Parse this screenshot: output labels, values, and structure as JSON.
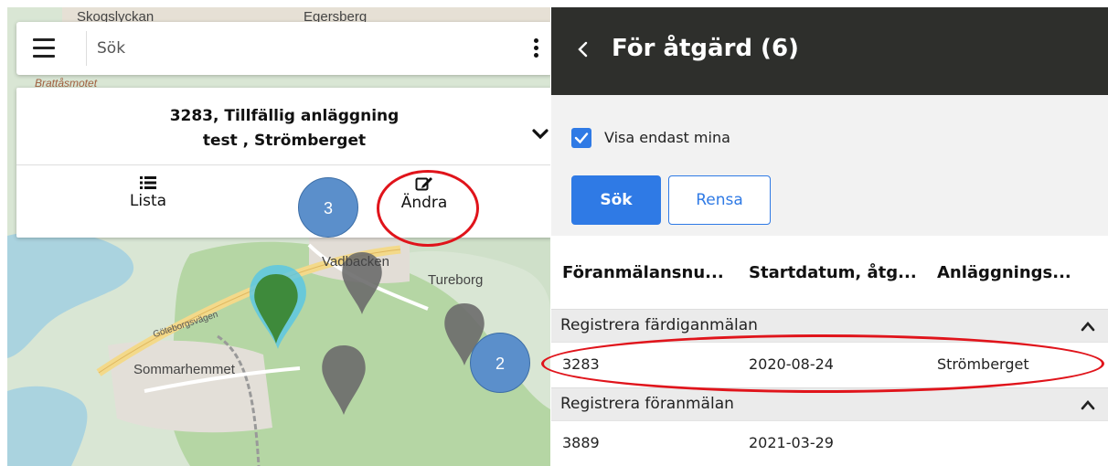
{
  "map": {
    "labels": {
      "top_left": "Skogslyckan",
      "top_right": "Egersberg",
      "road_top": "Brattåsmotet",
      "vadbacken": "Vadbacken",
      "tureborg": "Tureborg",
      "road": "Göteborgsvägen",
      "sommarhemmet": "Sommarhemmet"
    },
    "search": {
      "placeholder": "Sök",
      "menu_icon": "hamburger-icon",
      "more_icon": "more-vertical-icon"
    },
    "card": {
      "title_line1": "3283, Tillfällig anläggning",
      "title_line2": "test , Strömberget",
      "list_label": "Lista",
      "edit_label": "Ändra",
      "list_icon": "list-icon",
      "edit_icon": "edit-icon",
      "expand_icon": "chevron-down-icon"
    },
    "callouts": {
      "three": "3",
      "two": "2"
    },
    "colors": {
      "selected_pin": "#3e8a3b",
      "selected_halo": "#56c6e6",
      "pin": "#6b6b6b",
      "callout": "#5b8fcb",
      "highlight": "#e0141b"
    }
  },
  "panel": {
    "title": "För åtgärd (6)",
    "back_icon": "chevron-left-icon",
    "only_mine_label": "Visa endast mina",
    "only_mine_checked": true,
    "search_button": "Sök",
    "clear_button": "Rensa",
    "columns": [
      "Föranmälansnu...",
      "Startdatum, åtg...",
      "Anläggnings..."
    ],
    "groups": [
      {
        "title": "Registrera färdiganmälan",
        "rows": [
          {
            "number": "3283",
            "start": "2020-08-24",
            "facility": "Strömberget"
          }
        ]
      },
      {
        "title": "Registrera föranmälan",
        "rows": [
          {
            "number": "3889",
            "start": "2021-03-29",
            "facility": ""
          }
        ]
      }
    ],
    "colors": {
      "header_bg": "#2e2f2c",
      "accent": "#2f7ae5"
    }
  }
}
